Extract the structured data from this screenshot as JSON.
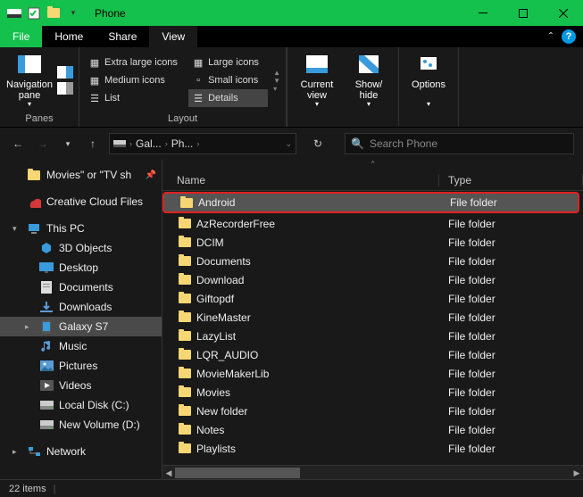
{
  "window": {
    "title": "Phone"
  },
  "tabs": {
    "file": "File",
    "home": "Home",
    "share": "Share",
    "view": "View"
  },
  "ribbon": {
    "panes": {
      "btn": "Navigation\npane",
      "label": "Panes"
    },
    "layout": {
      "opts": [
        "Extra large icons",
        "Large icons",
        "Medium icons",
        "Small icons",
        "List",
        "Details"
      ],
      "label": "Layout"
    },
    "curview": {
      "current": "Current\nview",
      "showhide": "Show/\nhide"
    },
    "options": "Options"
  },
  "nav": {
    "crumbs": [
      "Gal...",
      "Ph..."
    ],
    "search_placeholder": "Search Phone"
  },
  "sidebar": [
    {
      "label": "Movies\" or \"TV sh",
      "icon": "folder",
      "pin": true
    },
    {
      "label": "Creative Cloud Files",
      "icon": "cc"
    },
    {
      "label": "This PC",
      "icon": "pc",
      "caret": "▾"
    },
    {
      "label": "3D Objects",
      "icon": "3d",
      "indent": true
    },
    {
      "label": "Desktop",
      "icon": "desktop",
      "indent": true
    },
    {
      "label": "Documents",
      "icon": "docs",
      "indent": true
    },
    {
      "label": "Downloads",
      "icon": "dl",
      "indent": true
    },
    {
      "label": "Galaxy S7",
      "icon": "phone",
      "indent": true,
      "caret": "▸",
      "sel": true
    },
    {
      "label": "Music",
      "icon": "music",
      "indent": true
    },
    {
      "label": "Pictures",
      "icon": "pics",
      "indent": true
    },
    {
      "label": "Videos",
      "icon": "vids",
      "indent": true
    },
    {
      "label": "Local Disk (C:)",
      "icon": "disk",
      "indent": true
    },
    {
      "label": "New Volume (D:)",
      "icon": "disk",
      "indent": true
    },
    {
      "label": "Network",
      "icon": "net",
      "caret": "▸"
    }
  ],
  "columns": {
    "name": "Name",
    "type": "Type"
  },
  "rows": [
    {
      "name": "Android",
      "type": "File folder",
      "hl": true
    },
    {
      "name": "AzRecorderFree",
      "type": "File folder"
    },
    {
      "name": "DCIM",
      "type": "File folder"
    },
    {
      "name": "Documents",
      "type": "File folder"
    },
    {
      "name": "Download",
      "type": "File folder"
    },
    {
      "name": "Giftopdf",
      "type": "File folder"
    },
    {
      "name": "KineMaster",
      "type": "File folder"
    },
    {
      "name": "LazyList",
      "type": "File folder"
    },
    {
      "name": "LQR_AUDIO",
      "type": "File folder"
    },
    {
      "name": "MovieMakerLib",
      "type": "File folder"
    },
    {
      "name": "Movies",
      "type": "File folder"
    },
    {
      "name": "New folder",
      "type": "File folder"
    },
    {
      "name": "Notes",
      "type": "File folder"
    },
    {
      "name": "Playlists",
      "type": "File folder"
    }
  ],
  "status": "22 items"
}
